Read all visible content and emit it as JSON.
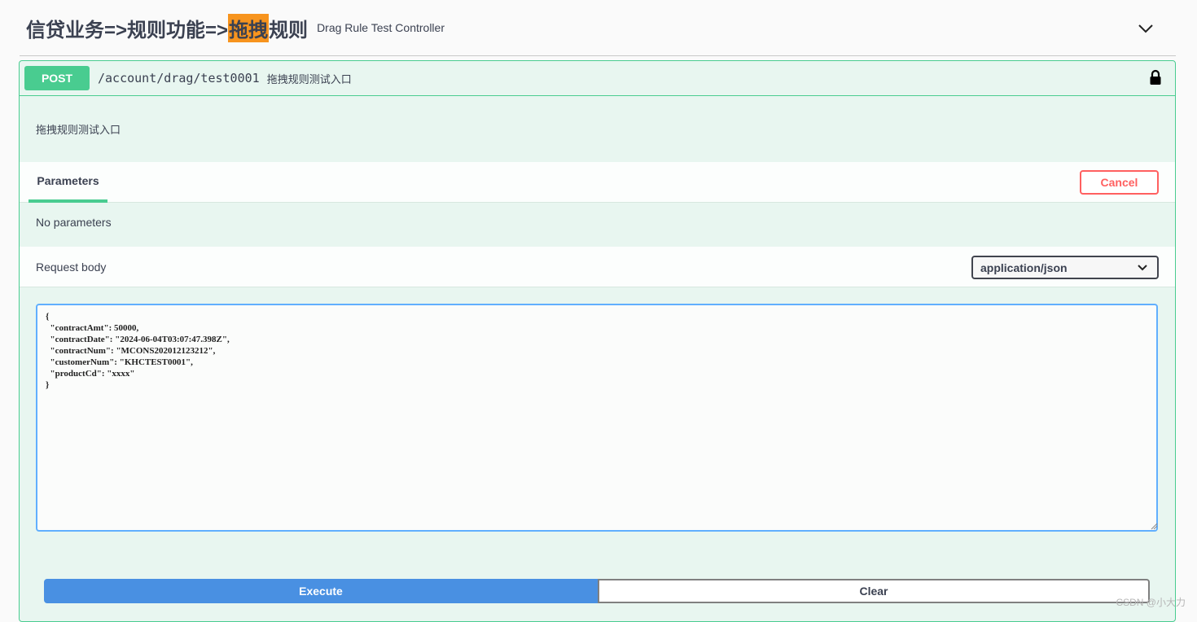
{
  "tag": {
    "title_prefix": "信贷业务=>规则功能=>",
    "title_highlight": "拖拽",
    "title_suffix": "规则",
    "description": "Drag Rule Test Controller"
  },
  "operation": {
    "method": "POST",
    "path": "/account/drag/test0001",
    "summary": "拖拽规则测试入口",
    "description": "拖拽规则测试入口"
  },
  "parameters": {
    "tab_label": "Parameters",
    "cancel_label": "Cancel",
    "empty_text": "No parameters"
  },
  "request_body": {
    "label": "Request body",
    "content_type": "application/json",
    "value": "{\n  \"contractAmt\": 50000,\n  \"contractDate\": \"2024-06-04T03:07:47.398Z\",\n  \"contractNum\": \"MCONS202012123212\",\n  \"customerNum\": \"KHCTEST0001\",\n  \"productCd\": \"xxxx\"\n}"
  },
  "actions": {
    "execute_label": "Execute",
    "clear_label": "Clear"
  },
  "watermark": "CSDN @小大力",
  "colors": {
    "post_green": "#49cc90",
    "execute_blue": "#4990e2",
    "cancel_red": "#ff6060",
    "highlight_orange": "#f7941e"
  }
}
